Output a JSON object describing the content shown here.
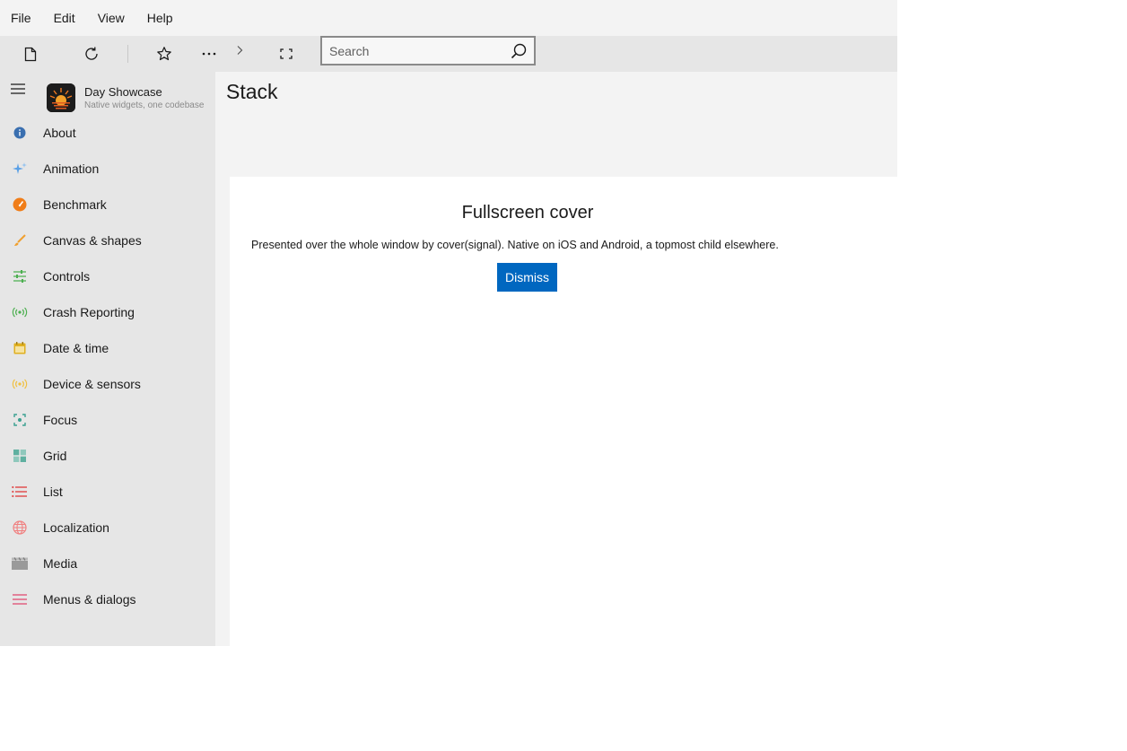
{
  "menubar": {
    "items": [
      "File",
      "Edit",
      "View",
      "Help"
    ]
  },
  "toolbar": {
    "buttons": [
      "new-page-icon",
      "refresh-icon",
      "star-icon",
      "more-icon",
      "chevron-right-icon",
      "fit-screen-icon"
    ],
    "search": {
      "placeholder": "Search",
      "value": ""
    }
  },
  "sidebar": {
    "app_title": "Day Showcase",
    "app_subtitle": "Native widgets, one codebase",
    "items": [
      {
        "label": "About",
        "icon": "info-icon",
        "color": "#3a6fb0"
      },
      {
        "label": "Animation",
        "icon": "sparkle-icon",
        "color": "#5aa0e6"
      },
      {
        "label": "Benchmark",
        "icon": "speedometer-icon",
        "color": "#f07d18"
      },
      {
        "label": "Canvas & shapes",
        "icon": "brush-icon",
        "color": "#f0a030"
      },
      {
        "label": "Controls",
        "icon": "sliders-icon",
        "color": "#4caf50"
      },
      {
        "label": "Crash Reporting",
        "icon": "broadcast-icon",
        "color": "#4caf50"
      },
      {
        "label": "Date & time",
        "icon": "calendar-icon",
        "color": "#e0b020"
      },
      {
        "label": "Device & sensors",
        "icon": "sensor-icon",
        "color": "#f0c040"
      },
      {
        "label": "Focus",
        "icon": "focus-icon",
        "color": "#3aa090"
      },
      {
        "label": "Grid",
        "icon": "grid-icon",
        "color": "#5fb0a0"
      },
      {
        "label": "List",
        "icon": "list-icon",
        "color": "#e05050"
      },
      {
        "label": "Localization",
        "icon": "globe-icon",
        "color": "#f08080"
      },
      {
        "label": "Media",
        "icon": "clapperboard-icon",
        "color": "#9a9a9a"
      },
      {
        "label": "Menus & dialogs",
        "icon": "menu-lines-icon",
        "color": "#e06080"
      }
    ]
  },
  "page": {
    "title": "Stack"
  },
  "cover": {
    "title": "Fullscreen cover",
    "text": "Presented over the whole window by cover(signal). Native on iOS and Android, a topmost child elsewhere.",
    "dismiss_label": "Dismiss",
    "accent": "#0067c0"
  }
}
